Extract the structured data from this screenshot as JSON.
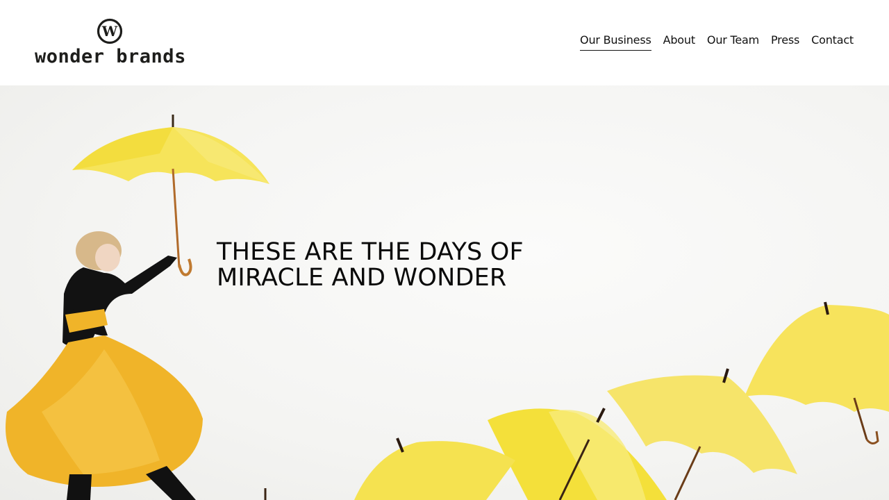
{
  "brand": {
    "mark_letter": "W",
    "name": "wonder brands"
  },
  "nav": {
    "items": [
      {
        "label": "Our Business",
        "active": true
      },
      {
        "label": "About",
        "active": false
      },
      {
        "label": "Our Team",
        "active": false
      },
      {
        "label": "Press",
        "active": false
      },
      {
        "label": "Contact",
        "active": false
      }
    ]
  },
  "hero": {
    "headline_line1": "THESE ARE THE DAYS OF",
    "headline_line2": "MIRACLE AND WONDER",
    "image_subject": "woman-with-yellow-umbrellas",
    "colors": {
      "umbrella": "#f5df3c",
      "dress": "#f0b429",
      "top": "#111111",
      "background": "#f4f4f2"
    }
  }
}
